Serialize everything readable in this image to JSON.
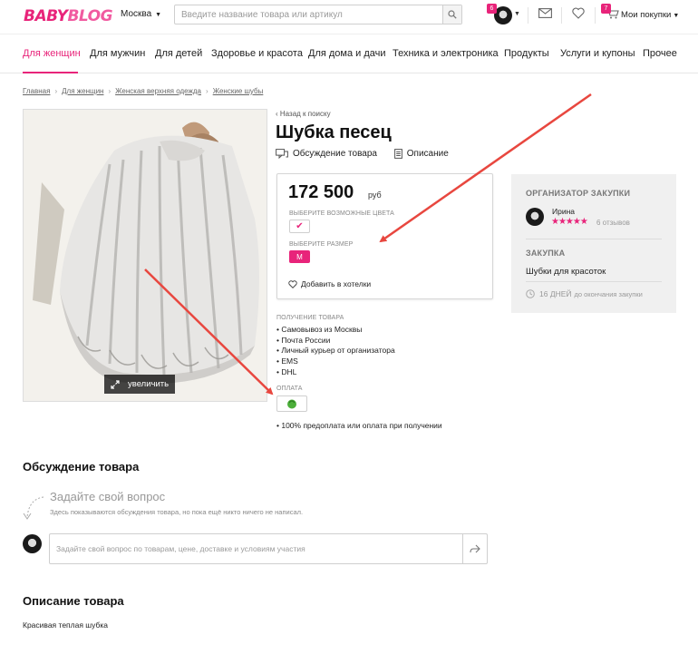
{
  "header": {
    "logo_part1": "BABY",
    "logo_part2": "BLOG",
    "city": "Москва",
    "search_placeholder": "Введите название товара или артикул",
    "profile_badge": "6",
    "cart_badge": "7",
    "cart_label": "Мои покупки"
  },
  "nav": {
    "items": [
      {
        "label": "Для женщин",
        "active": true
      },
      {
        "label": "Для мужчин"
      },
      {
        "label": "Для детей"
      },
      {
        "label": "Здоровье и красота"
      },
      {
        "label": "Для дома и дачи"
      },
      {
        "label": "Техника и электроника"
      },
      {
        "label": "Продукты"
      },
      {
        "label": "Услуги и купоны"
      },
      {
        "label": "Прочее"
      }
    ]
  },
  "breadcrumbs": [
    "Главная",
    "Для женщин",
    "Женская верхняя одежда",
    "Женские шубы"
  ],
  "photo": {
    "zoom_label": "увеличить"
  },
  "product": {
    "back_link": "‹ Назад к поиску",
    "title": "Шубка песец",
    "tab_discussion": "Обсуждение товара",
    "tab_description": "Описание",
    "price": "172 500",
    "currency": "руб",
    "colors_label": "ВЫБЕРИТЕ ВОЗМОЖНЫЕ ЦВЕТА",
    "size_label": "ВЫБЕРИТЕ РАЗМЕР",
    "size_value": "M",
    "wishlist_label": "Добавить в хотелки",
    "delivery_title": "ПОЛУЧЕНИЕ ТОВАРА",
    "delivery_options": [
      "Самовывоз из Москвы",
      "Почта России",
      "Личный курьер от организатора",
      "EMS",
      "DHL"
    ],
    "payment_title": "ОПЛАТА",
    "payment_note": "• 100% предоплата или оплата при получении"
  },
  "organizer": {
    "title": "ОРГАНИЗАТОР ЗАКУПКИ",
    "name": "Ирина",
    "rating": 5,
    "reviews": "6 отзывов",
    "purchase_title": "ЗАКУПКА",
    "purchase_name": "Шубки для красоток",
    "days_number": "16 ДНЕЙ",
    "days_suffix": "до окончания закупки"
  },
  "discussion": {
    "title": "Обсуждение товара",
    "ask_title": "Задайте свой вопрос",
    "ask_sub": "Здесь показываются обсуждения товара, но пока ещё никто ничего не написал.",
    "input_placeholder": "Задайте свой вопрос по товарам, цене, доставке и условиям участия"
  },
  "description": {
    "title": "Описание товара",
    "text": "Красивая теплая шубка"
  },
  "colors": {
    "accent": "#e8247a",
    "arrow": "#e8473f"
  }
}
